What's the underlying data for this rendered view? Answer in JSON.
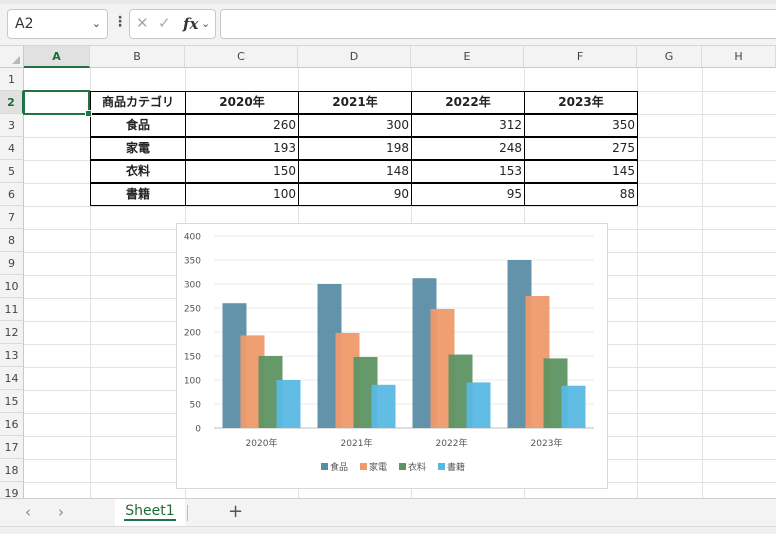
{
  "formula_bar": {
    "name_box": "A2",
    "formula": "",
    "fx_label": "fx"
  },
  "columns": [
    {
      "name": "A",
      "selected": true
    },
    {
      "name": "B",
      "selected": false
    },
    {
      "name": "C",
      "selected": false
    },
    {
      "name": "D",
      "selected": false
    },
    {
      "name": "E",
      "selected": false
    },
    {
      "name": "F",
      "selected": false
    },
    {
      "name": "G",
      "selected": false
    },
    {
      "name": "H",
      "selected": false
    }
  ],
  "rows": [
    "1",
    "2",
    "3",
    "4",
    "5",
    "6",
    "7",
    "8",
    "9",
    "10",
    "11",
    "12",
    "13",
    "14",
    "15",
    "16",
    "17",
    "18",
    "19"
  ],
  "selected_row": "2",
  "table": {
    "header": [
      "商品カテゴリ",
      "2020年",
      "2021年",
      "2022年",
      "2023年"
    ],
    "rows": [
      {
        "label": "食品",
        "values": [
          260,
          300,
          312,
          350
        ]
      },
      {
        "label": "家電",
        "values": [
          193,
          198,
          248,
          275
        ]
      },
      {
        "label": "衣料",
        "values": [
          150,
          148,
          153,
          145
        ]
      },
      {
        "label": "書籍",
        "values": [
          100,
          90,
          95,
          88
        ]
      }
    ]
  },
  "chart_data": {
    "type": "bar",
    "categories": [
      "2020年",
      "2021年",
      "2022年",
      "2023年"
    ],
    "series": [
      {
        "name": "食品",
        "values": [
          260,
          300,
          312,
          350
        ],
        "color": "#5b8ca6"
      },
      {
        "name": "家電",
        "values": [
          193,
          198,
          248,
          275
        ],
        "color": "#ef9a6c"
      },
      {
        "name": "衣料",
        "values": [
          150,
          148,
          153,
          145
        ],
        "color": "#5e9462"
      },
      {
        "name": "書籍",
        "values": [
          100,
          90,
          95,
          88
        ],
        "color": "#5ab9e3"
      }
    ],
    "ylim": [
      0,
      400
    ],
    "yticks": [
      0,
      50,
      100,
      150,
      200,
      250,
      300,
      350,
      400
    ],
    "grid": true,
    "legend": "bottom",
    "title": "",
    "xlabel": "",
    "ylabel": ""
  },
  "sheets": [
    {
      "name": "Sheet1",
      "active": true
    }
  ],
  "tabbar": {
    "add_label": "+"
  },
  "accent_color": "#217346"
}
